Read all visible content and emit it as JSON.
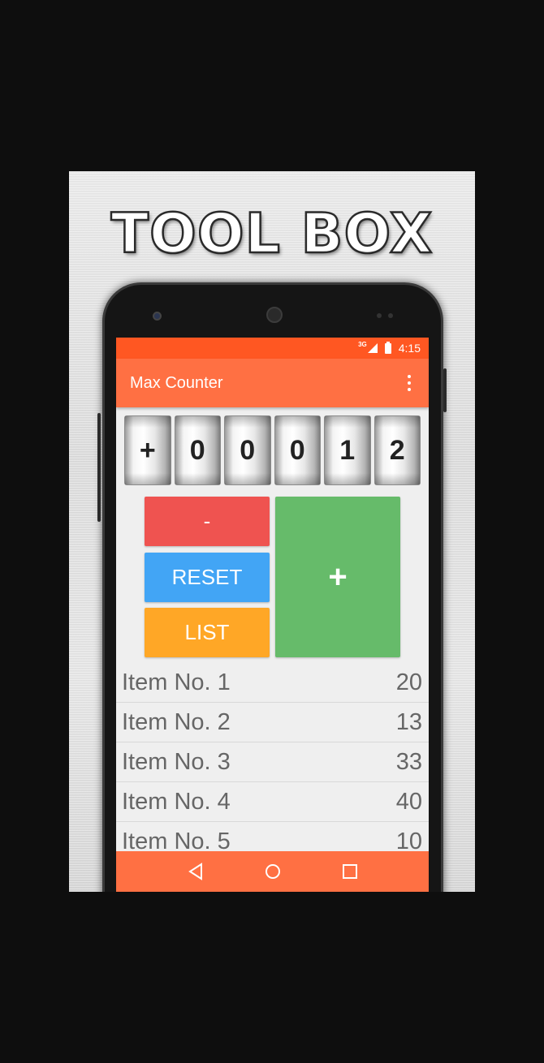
{
  "banner": {
    "title": "TOOL BOX"
  },
  "status_bar": {
    "network": "3G",
    "time": "4:15"
  },
  "app_bar": {
    "title": "Max Counter",
    "overflow_icon": "more-vert-icon"
  },
  "counter": {
    "digits": [
      "+",
      "0",
      "0",
      "0",
      "1",
      "2"
    ]
  },
  "buttons": {
    "minus": "-",
    "reset": "RESET",
    "list": "LIST",
    "plus": "+"
  },
  "list": {
    "items": [
      {
        "label": "Item No. 1",
        "value": "20"
      },
      {
        "label": "Item No. 2",
        "value": "13"
      },
      {
        "label": "Item No. 3",
        "value": "33"
      },
      {
        "label": "Item No. 4",
        "value": "40"
      },
      {
        "label": "Item No. 5",
        "value": "10"
      }
    ]
  },
  "nav_bar": {
    "icons": [
      "back-icon",
      "home-icon",
      "recents-icon"
    ]
  },
  "colors": {
    "status_bar": "#ff5722",
    "app_bar": "#ff7043",
    "minus": "#ef5350",
    "reset": "#42a5f5",
    "list": "#ffa726",
    "plus": "#66bb6a"
  }
}
